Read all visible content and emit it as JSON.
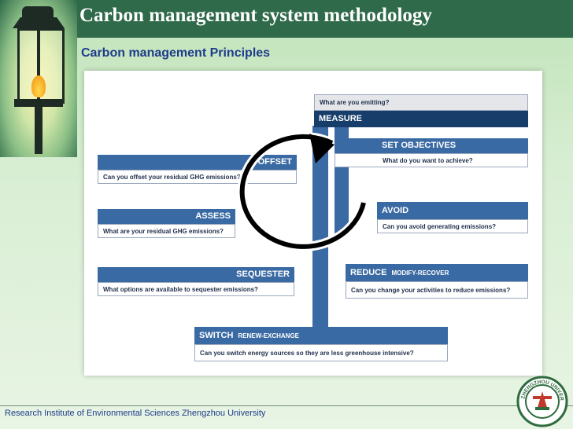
{
  "slide": {
    "title": "Carbon management system methodology",
    "subtitle": "Carbon management Principles",
    "footer": "Research Institute of Environmental Sciences Zhengzhou University",
    "seal_text": "ZHENGZHOU UNIVERSITY"
  },
  "diagram": {
    "measure": {
      "question": "What are you emitting?",
      "label": "MEASURE"
    },
    "set_objectives": {
      "label": "SET OBJECTIVES",
      "question": "What do you want to achieve?"
    },
    "offset": {
      "label": "OFFSET",
      "question": "Can you offset your residual GHG emissions?"
    },
    "assess": {
      "label": "ASSESS",
      "question": "What are your residual GHG emissions?"
    },
    "avoid": {
      "label": "AVOID",
      "question": "Can you avoid generating emissions?"
    },
    "sequester": {
      "label": "SEQUESTER",
      "question": "What options are available to sequester emissions?"
    },
    "reduce": {
      "label": "REDUCE",
      "sublabel": "MODIFY-RECOVER",
      "question": "Can you change your activities to reduce emissions?"
    },
    "switch": {
      "label": "SWITCH",
      "sublabel": "RENEW-EXCHANGE",
      "question": "Can you switch energy sources so they are less greenhouse intensive?"
    }
  },
  "colors": {
    "header_bar": "#2f6a4a",
    "box_blue": "#3a6aa3",
    "box_dark": "#173d6b",
    "subtitle": "#1f3c8a"
  }
}
